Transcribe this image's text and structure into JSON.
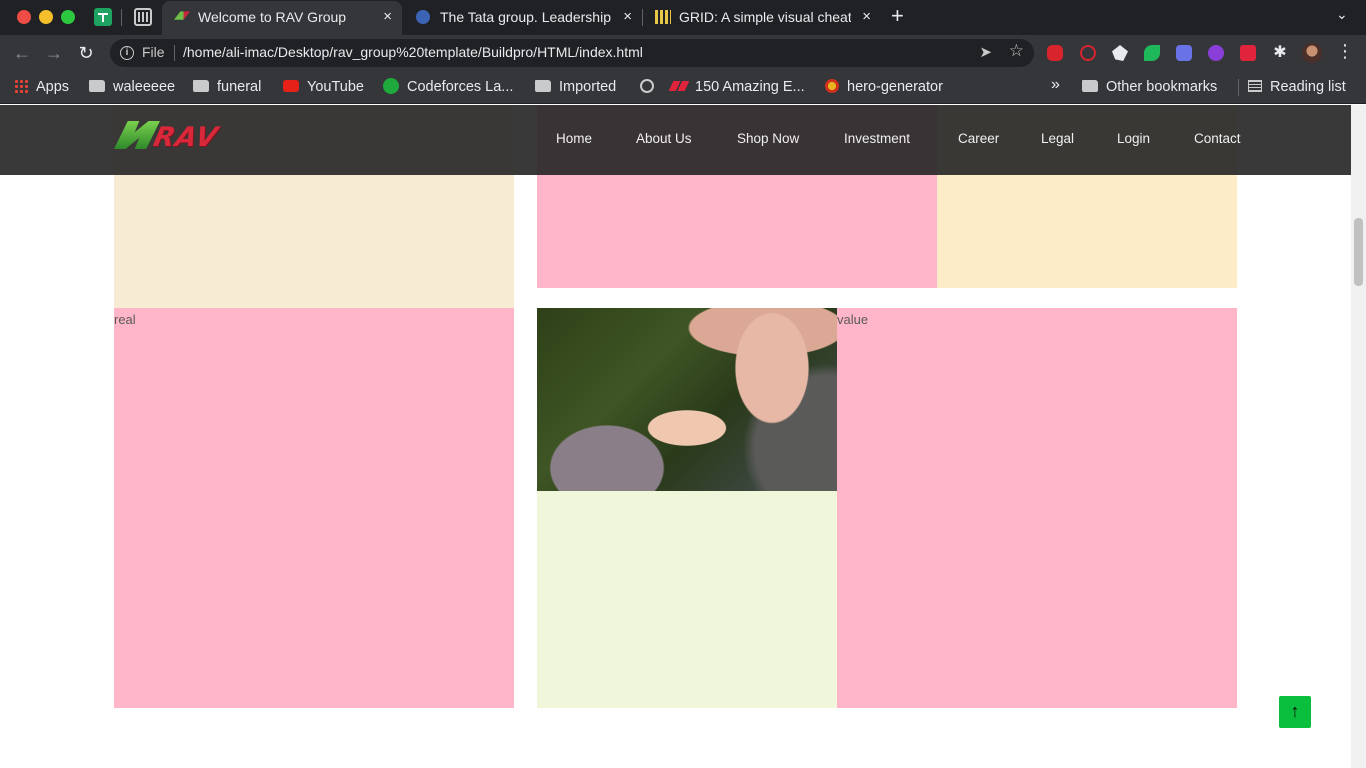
{
  "browser": {
    "tabs": [
      {
        "title": "Welcome to RAV Group",
        "active": true
      },
      {
        "title": "The Tata group. Leadership",
        "active": false
      },
      {
        "title": "GRID: A simple visual cheatsheet",
        "active": false
      }
    ],
    "close_glyph": "×",
    "new_tab_glyph": "+",
    "url_scheme_label": "File",
    "url": "/home/ali-imac/Desktop/rav_group%20template/Buildpro/HTML/index.html",
    "bookmarks": [
      {
        "label": "Apps",
        "icon": "apps-grid-icon"
      },
      {
        "label": "waleeeee",
        "icon": "folder-icon"
      },
      {
        "label": "funeral",
        "icon": "folder-icon"
      },
      {
        "label": "YouTube",
        "icon": "youtube-icon"
      },
      {
        "label": "Codeforces La...",
        "icon": "codeforces-icon"
      },
      {
        "label": "Imported",
        "icon": "folder-icon"
      },
      {
        "label": "",
        "icon": "globe-icon"
      },
      {
        "label": "150 Amazing E...",
        "icon": "webdesign-icon"
      },
      {
        "label": "hero-generator",
        "icon": "hero-icon"
      }
    ],
    "overflow_glyph": "»",
    "other_bookmarks": "Other bookmarks",
    "reading_list": "Reading list"
  },
  "site": {
    "logo_text": "RAV",
    "nav": [
      "Home",
      "About Us",
      "Shop Now",
      "Investment",
      "Career",
      "Legal",
      "Login",
      "Contact"
    ],
    "labels": {
      "left_block": "real",
      "right_block": "value"
    },
    "back_to_top_glyph": "↑",
    "colors": {
      "cream": "#f7ebd4",
      "pink": "#ffb6c8",
      "sand": "#fdecc8",
      "lime": "#eff6da",
      "navbar": "#282828",
      "back_to_top": "#0bbf3e"
    }
  }
}
